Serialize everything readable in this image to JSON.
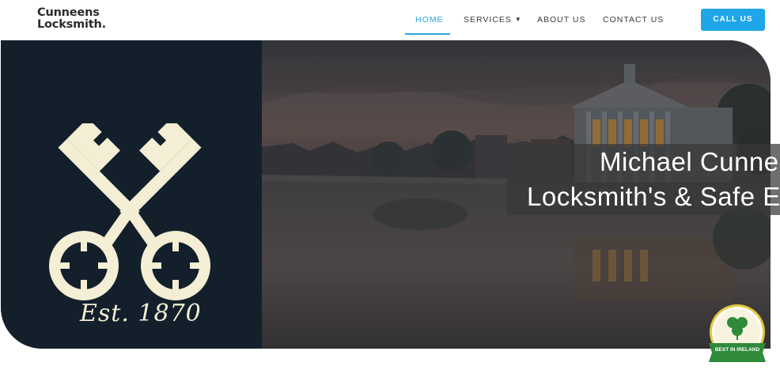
{
  "header": {
    "logo_line1": "Cunneens",
    "logo_line2": "Locksmith.",
    "nav": [
      {
        "label": "HOME"
      },
      {
        "label": "SERVICES"
      },
      {
        "label": "ABOUT US"
      },
      {
        "label": "CONTACT US"
      }
    ],
    "cta_label": "CALL US"
  },
  "hero": {
    "est_text": "Est. 1870",
    "title_line1": "Michael Cunne",
    "title_line2": "Locksmith's & Safe E"
  },
  "badge": {
    "label": "BEST IN IRELAND"
  },
  "colors": {
    "accent": "#2aa5dc",
    "cta_bg": "#1ea6e8",
    "panel_bg": "#13202c",
    "key_cream": "#f3eed4",
    "badge_green": "#2f8a3a",
    "badge_gold": "#e3c83c"
  },
  "icons": {
    "services_chevron": "chevron-down-icon",
    "logo_graphic": "crossed-keys-icon",
    "badge_graphic": "shamrock-icon"
  }
}
